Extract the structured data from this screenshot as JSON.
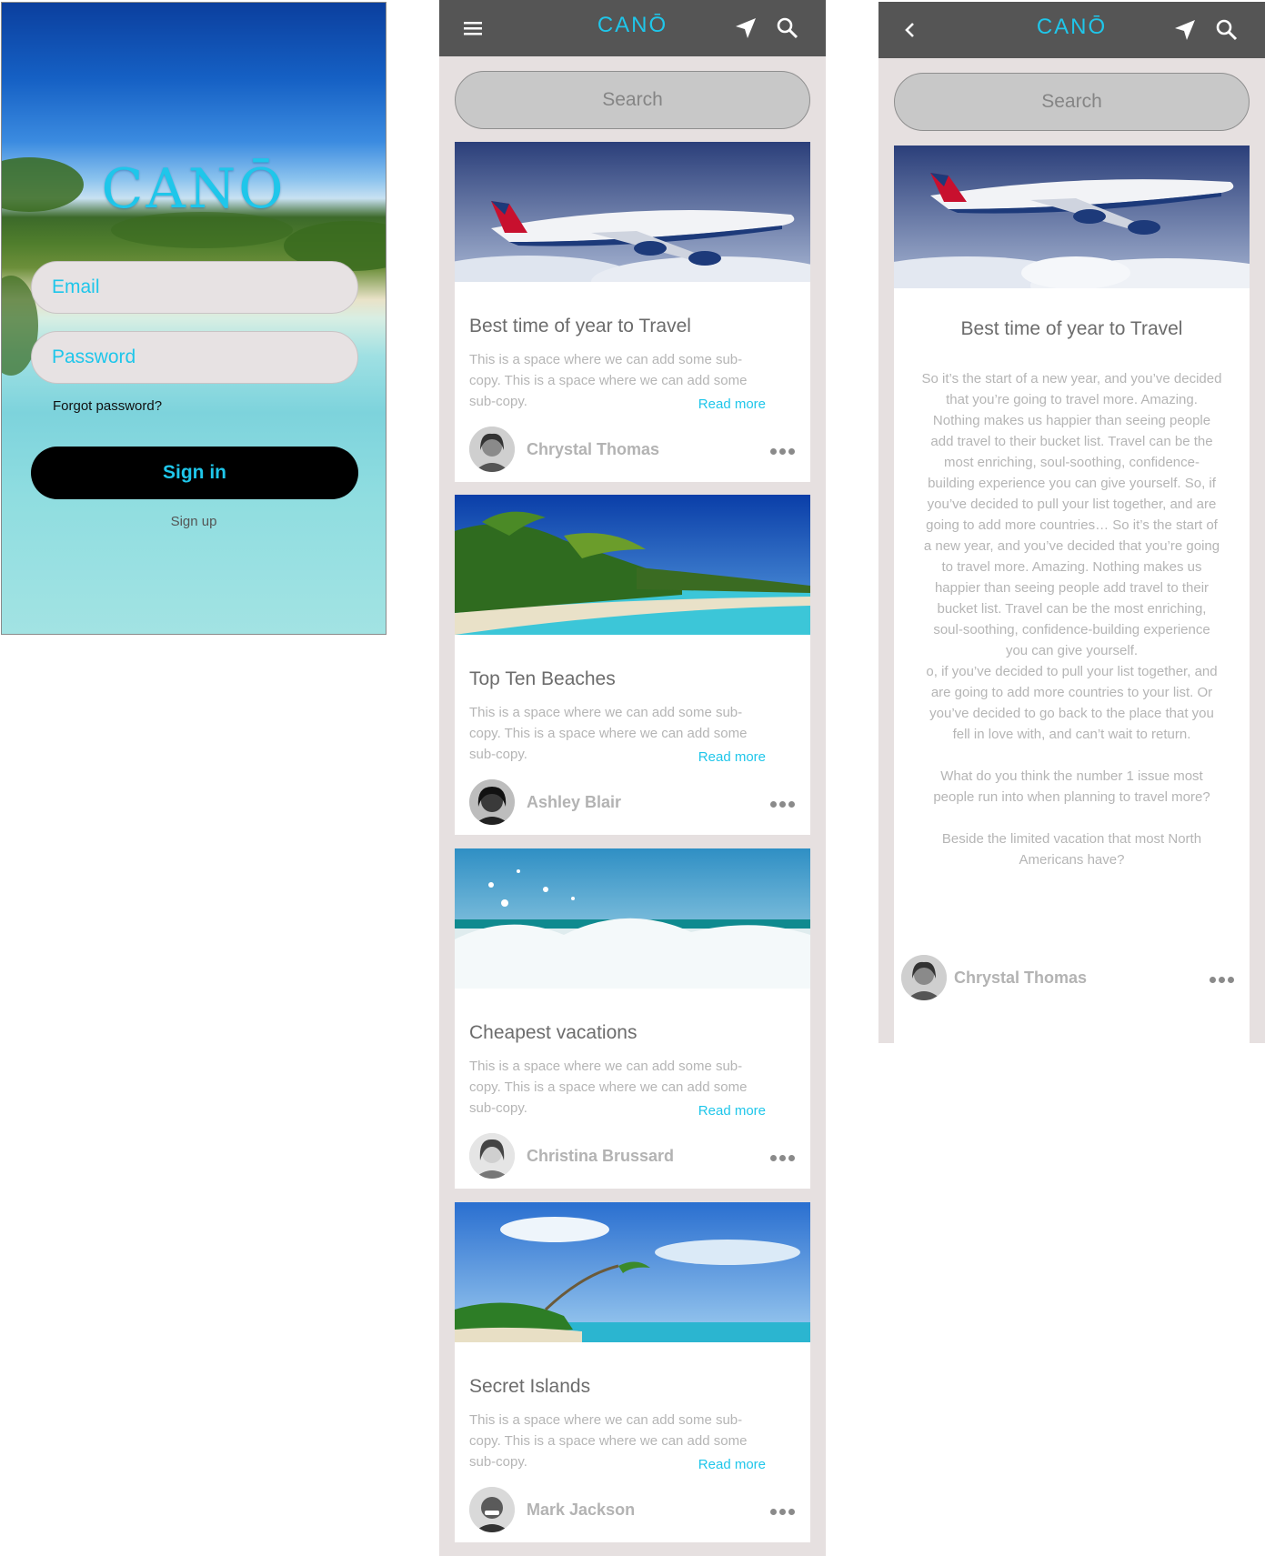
{
  "login": {
    "logo": "CANŌ",
    "email_placeholder": "Email",
    "password_placeholder": "Password",
    "forgot": "Forgot password?",
    "signin": "Sign in",
    "signup": "Sign up"
  },
  "brand": "CANŌ",
  "search_placeholder": "Search",
  "feed": [
    {
      "title": "Best time of year to Travel",
      "subcopy": "This is a space where we can add some sub-copy. This is a space where we can add some sub-copy.",
      "read_more": "Read more",
      "author": "Chrystal Thomas",
      "image": "airplane"
    },
    {
      "title": "Top Ten Beaches",
      "subcopy": "This is a space where we can add some sub-copy. This is a space where we can add some sub-copy.",
      "read_more": "Read more",
      "author": "Ashley Blair",
      "image": "beach"
    },
    {
      "title": "Cheapest vacations",
      "subcopy": "This is a space where we can add some sub-copy. This is a space where we can add some sub-copy.",
      "read_more": "Read more",
      "author": "Christina Brussard",
      "image": "wave"
    },
    {
      "title": "Secret Islands",
      "subcopy": "This is a space where we can add some sub-copy. This is a space where we can add some sub-copy.",
      "read_more": "Read more",
      "author": "Mark Jackson",
      "image": "island"
    }
  ],
  "article": {
    "title": "Best time of year to Travel",
    "paragraphs": [
      "So it’s the start of a new year, and you’ve decided that you’re going to travel more. Amazing. Nothing makes us happier than seeing people add travel to their bucket list. Travel can be the most enriching, soul-soothing, confidence-building experience you can give yourself. So, if you’ve decided to pull your list together, and are going to add more countries… So it’s the start of a new year, and you’ve decided that you’re going to travel more. Amazing. Nothing makes us happier than seeing people add travel to their bucket list. Travel can be the most enriching, soul-soothing, confidence-building experience you can give yourself.\no, if you’ve decided to pull your list together, and are going to add more countries to your list. Or you’ve decided to go back to the place that you fell in love with, and can’t wait to return.",
      "What do you think the number 1 issue most people run into when planning to travel more?",
      "Beside the limited vacation that most North Americans have?"
    ],
    "author": "Chrystal Thomas"
  },
  "icons": {
    "menu": "menu-icon",
    "back": "back-arrow-icon",
    "location": "location-arrow-icon",
    "search": "search-icon",
    "more": "more-dots-icon"
  },
  "colors": {
    "accent": "#1fc6ea",
    "topbar": "#555555",
    "background": "#e6e0e0"
  }
}
